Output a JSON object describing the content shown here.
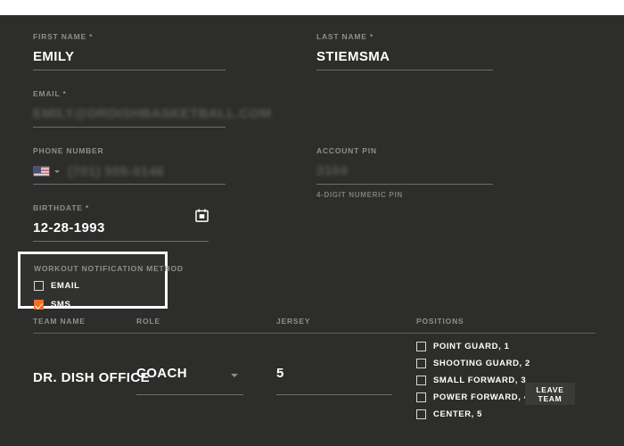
{
  "form": {
    "first_name": {
      "label": "FIRST NAME *",
      "value": "EMILY"
    },
    "last_name": {
      "label": "LAST NAME *",
      "value": "STIEMSMA"
    },
    "email": {
      "label": "EMAIL *",
      "value": "emily@drdishbasketball.com",
      "redacted": "true"
    },
    "phone": {
      "label": "PHONE NUMBER",
      "country_flag": "us-flag-icon",
      "value": "(701) 555-0146",
      "redacted": "true"
    },
    "account_pin": {
      "label": "ACCOUNT PIN",
      "value": "3104",
      "helper": "4-DIGIT NUMERIC PIN",
      "redacted": "true"
    },
    "birthdate": {
      "label": "BIRTHDATE *",
      "value": "12-28-1993",
      "icon": "calendar-icon"
    }
  },
  "notification": {
    "title": "WORKOUT NOTIFICATION METHOD",
    "options": [
      {
        "label": "EMAIL",
        "checked": false
      },
      {
        "label": "SMS",
        "checked": true
      }
    ],
    "highlight_color": "#ffffff",
    "accent_color": "#ef7023"
  },
  "team_table": {
    "columns": [
      "TEAM NAME",
      "ROLE",
      "JERSEY",
      "POSITIONS"
    ],
    "row": {
      "team_name": "DR. DISH OFFICE",
      "role": "COACH",
      "jersey": "5",
      "positions": [
        {
          "label": "POINT GUARD, 1",
          "checked": false
        },
        {
          "label": "SHOOTING GUARD, 2",
          "checked": false
        },
        {
          "label": "SMALL FORWARD, 3",
          "checked": false
        },
        {
          "label": "POWER FORWARD, 4",
          "checked": false
        },
        {
          "label": "CENTER, 5",
          "checked": false
        }
      ],
      "leave_team_label": "LEAVE TEAM"
    }
  },
  "theme": {
    "background": "#2d2d2b",
    "text": "#ffffff",
    "muted": "#8e8e8c",
    "accent": "#ef7023"
  }
}
